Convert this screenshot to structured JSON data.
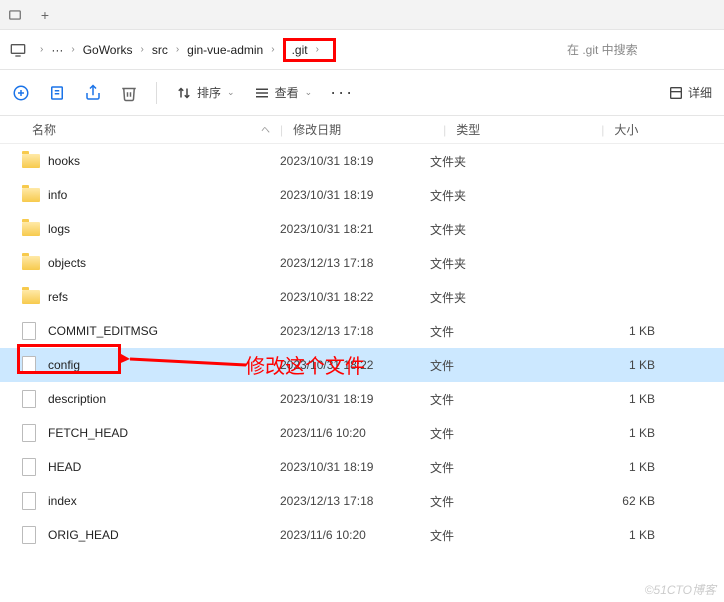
{
  "tabbar": {
    "plus": "+"
  },
  "breadcrumb": {
    "ellipsis": "···",
    "items": [
      "GoWorks",
      "src",
      "gin-vue-admin",
      ".git"
    ]
  },
  "search": {
    "placeholder": "在 .git 中搜索"
  },
  "toolbar": {
    "sort_label": "排序",
    "view_label": "查看",
    "details_label": "详细"
  },
  "columns": {
    "name": "名称",
    "date": "修改日期",
    "type": "类型",
    "size": "大小"
  },
  "files": [
    {
      "name": "hooks",
      "date": "2023/10/31 18:19",
      "type": "文件夹",
      "size": "",
      "kind": "folder"
    },
    {
      "name": "info",
      "date": "2023/10/31 18:19",
      "type": "文件夹",
      "size": "",
      "kind": "folder"
    },
    {
      "name": "logs",
      "date": "2023/10/31 18:21",
      "type": "文件夹",
      "size": "",
      "kind": "folder"
    },
    {
      "name": "objects",
      "date": "2023/12/13 17:18",
      "type": "文件夹",
      "size": "",
      "kind": "folder"
    },
    {
      "name": "refs",
      "date": "2023/10/31 18:22",
      "type": "文件夹",
      "size": "",
      "kind": "folder"
    },
    {
      "name": "COMMIT_EDITMSG",
      "date": "2023/12/13 17:18",
      "type": "文件",
      "size": "1 KB",
      "kind": "file"
    },
    {
      "name": "config",
      "date": "2023/10/31 18:22",
      "type": "文件",
      "size": "1 KB",
      "kind": "file",
      "selected": true
    },
    {
      "name": "description",
      "date": "2023/10/31 18:19",
      "type": "文件",
      "size": "1 KB",
      "kind": "file"
    },
    {
      "name": "FETCH_HEAD",
      "date": "2023/11/6 10:20",
      "type": "文件",
      "size": "1 KB",
      "kind": "file"
    },
    {
      "name": "HEAD",
      "date": "2023/10/31 18:19",
      "type": "文件",
      "size": "1 KB",
      "kind": "file"
    },
    {
      "name": "index",
      "date": "2023/12/13 17:18",
      "type": "文件",
      "size": "62 KB",
      "kind": "file"
    },
    {
      "name": "ORIG_HEAD",
      "date": "2023/11/6 10:20",
      "type": "文件",
      "size": "1 KB",
      "kind": "file"
    }
  ],
  "annotation": {
    "text": "修改这个文件"
  },
  "watermark": "©51CTO博客"
}
